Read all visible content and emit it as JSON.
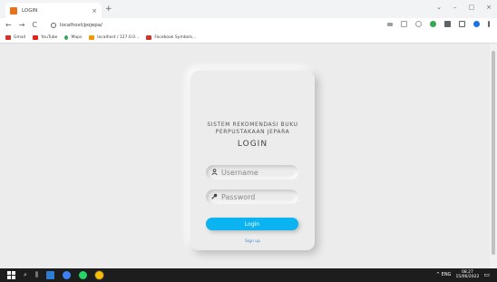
{
  "browser": {
    "tab_title": "LOGIN",
    "tab_close": "×",
    "new_tab": "+",
    "url": "localhost/pojepa/",
    "nav": {
      "back": "←",
      "forward": "→",
      "reload": "C"
    },
    "window_controls": {
      "minimize": "⌄",
      "restore": "–",
      "maximize": "▢",
      "close": "×"
    }
  },
  "bookmarks": [
    {
      "label": "Gmail",
      "color": "#d93025"
    },
    {
      "label": "YouTube",
      "color": "#e62117"
    },
    {
      "label": "Maps",
      "color": "#34a853"
    },
    {
      "label": "localhost / 127.0.0...",
      "color": "#f29900"
    },
    {
      "label": "Facebook Symbols...",
      "color": "#d93025"
    }
  ],
  "login": {
    "title": "SISTEM REKOMENDASI BUKU PERPUSTAKAAN JEPARA",
    "heading": "LOGIN",
    "username_placeholder": "Username",
    "password_placeholder": "Password",
    "login_button": "Login",
    "signup_link": "Sign up"
  },
  "taskbar": {
    "time": "08.27",
    "date": "15/06/2022",
    "tray": "^ ENG"
  },
  "colors": {
    "accent": "#0bb3f0",
    "page_bg": "#ececec",
    "taskbar_bg": "#1d1d1d"
  }
}
